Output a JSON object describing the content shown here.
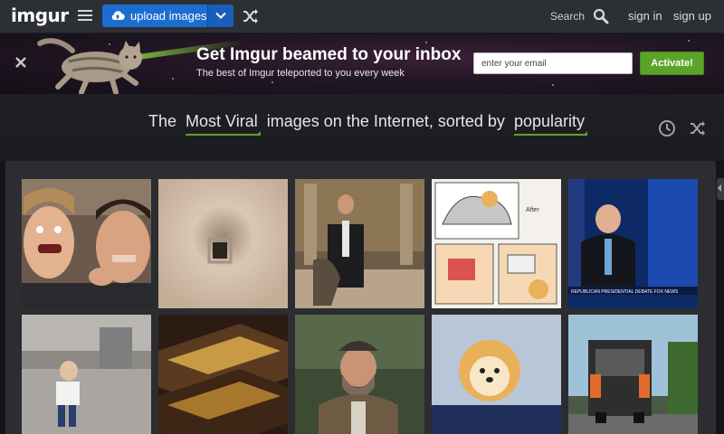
{
  "app": {
    "logo": "imgur"
  },
  "nav": {
    "upload_label": "upload images",
    "search_label": "Search",
    "sign_in": "sign in",
    "sign_up": "sign up"
  },
  "banner": {
    "title": "Get Imgur beamed to your inbox",
    "subtitle": "The best of Imgur teleported to you every week",
    "email_placeholder": "enter your email",
    "activate_label": "Activate!"
  },
  "headline": {
    "prefix": "The",
    "section": "Most Viral",
    "middle": "images on the Internet, sorted by",
    "sort": "popularity"
  },
  "gallery": {
    "tiles": [
      {
        "name": "two-women-funny-faces",
        "caption": ""
      },
      {
        "name": "blurry-closeup",
        "caption": ""
      },
      {
        "name": "man-in-suit-hallway",
        "caption": ""
      },
      {
        "name": "comic-car-dog",
        "caption": "After"
      },
      {
        "name": "politician-debate-stage",
        "caption": "REPUBLICAN PRESIDENTIAL DEBATE FOX NEWS"
      },
      {
        "name": "toddler-walking",
        "caption": ""
      },
      {
        "name": "stacked-chocolate-bars",
        "caption": ""
      },
      {
        "name": "bearded-man-cap",
        "caption": ""
      },
      {
        "name": "pomeranian-puppy",
        "caption": ""
      },
      {
        "name": "garbage-truck-workers",
        "caption": ""
      }
    ]
  },
  "colors": {
    "accent_green": "#5ca32a",
    "upload_blue": "#1c6dd0",
    "topbar": "#2c2f34"
  }
}
